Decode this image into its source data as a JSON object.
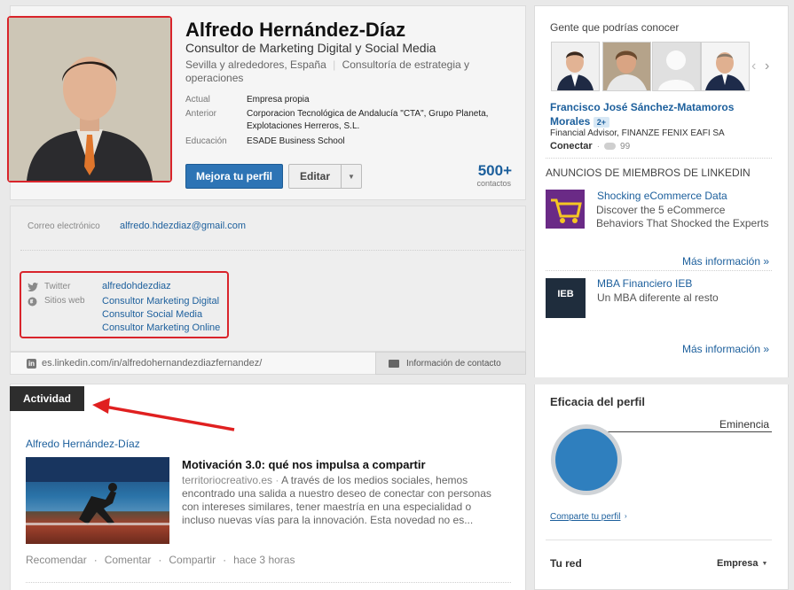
{
  "profile": {
    "name": "Alfredo Hernández-Díaz",
    "headline": "Consultor de Marketing Digital y Social Media",
    "location": "Sevilla y alrededores, España",
    "industry": "Consultoría de estrategia y operaciones",
    "current_label": "Actual",
    "current_value": "Empresa propia",
    "previous_label": "Anterior",
    "previous_value": "Corporacion Tecnológica de Andalucía \"CTA\", Grupo Planeta, Explotaciones Herreros, S.L.",
    "education_label": "Educación",
    "education_value": "ESADE Business School",
    "improve_button": "Mejora tu perfil",
    "edit_button": "Editar",
    "connections_count": "500+",
    "connections_label": "contactos"
  },
  "contact": {
    "email_label": "Correo electrónico",
    "email_value": "alfredo.hdezdiaz@gmail.com",
    "twitter_label": "Twitter",
    "twitter_value": "alfredohdezdiaz",
    "websites_label": "Sitios web",
    "websites": [
      "Consultor Marketing Digital",
      "Consultor Social Media",
      "Consultor Marketing Online"
    ],
    "public_url": "es.linkedin.com/in/alfredohernandezdiazfernandez/",
    "contact_info_tab": "Información de contacto"
  },
  "activity": {
    "tab_label": "Actividad",
    "author": "Alfredo Hernández-Díaz",
    "post_title": "Motivación 3.0: qué nos impulsa a compartir",
    "post_source": "territoriocreativo.es",
    "post_excerpt": "A través de los medios sociales, hemos encontrado una salida a nuestro deseo de conectar con personas con intereses similares, tener maestría en una especialidad o incluso nuevas vías para la innovación. Esta novedad no es...",
    "actions": [
      "Recomendar",
      "Comentar",
      "Compartir"
    ],
    "time": "hace 3 horas"
  },
  "pymk": {
    "title": "Gente que podrías conocer",
    "person_name": "Francisco José Sánchez-Matamoros Morales",
    "degree": "2+",
    "person_headline": "Financial Advisor, FINANZE FENIX EAFI SA",
    "connect_label": "Conectar",
    "shared_count": "99"
  },
  "ads": {
    "title": "ANUNCIOS DE MIEMBROS DE LINKEDIN",
    "items": [
      {
        "title": "Shocking eCommerce Data",
        "body": "Discover the 5 eCommerce Behaviors That Shocked the Experts",
        "more": "Más información »"
      },
      {
        "title": "MBA Financiero IEB",
        "body": "Un MBA diferente al resto",
        "more": "Más información »",
        "logo_text": "IEB"
      }
    ]
  },
  "strength": {
    "title": "Eficacia del perfil",
    "level": "Eminencia",
    "share_link": "Comparte tu perfil"
  },
  "network": {
    "title": "Tu red",
    "filter": "Empresa"
  },
  "colors": {
    "accent": "#2d74b5",
    "highlight_red": "#d9242b",
    "link": "#1c5f9c"
  }
}
